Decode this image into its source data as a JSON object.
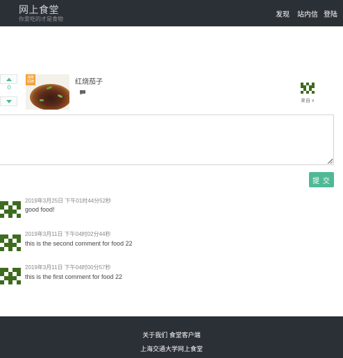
{
  "header": {
    "brand_title": "网上食堂",
    "brand_subtitle": "你爱吃的才是食物",
    "nav": {
      "discover": "发现",
      "messages": "站内信",
      "login": "登陆"
    }
  },
  "food": {
    "vote_count": "0",
    "badge": "湘菜 招牌",
    "name": "红烧茄子",
    "author_text": "来自 x"
  },
  "comment_form": {
    "value": "",
    "submit_label": "提 交"
  },
  "comments": [
    {
      "time": "2019年3月25日 下午01时44分52秒",
      "text": "good food!"
    },
    {
      "time": "2019年3月11日 下午04时02分44秒",
      "text": "this is the second comment for food 22"
    },
    {
      "time": "2019年3月11日 下午04时00分57秒",
      "text": "this is the first comment for food 22"
    }
  ],
  "footer": {
    "about": "关于我们",
    "client": "食堂客户端",
    "copyright": "上海交通大学网上食堂"
  },
  "colors": {
    "header_bg": "#2b2f36",
    "accent": "#4fb995",
    "avatar_green": "#3e6b1f"
  },
  "icons": {
    "upvote": "triangle-up-icon",
    "downvote": "triangle-down-icon",
    "comment": "speech-bubble-icon",
    "avatar": "identicon"
  }
}
